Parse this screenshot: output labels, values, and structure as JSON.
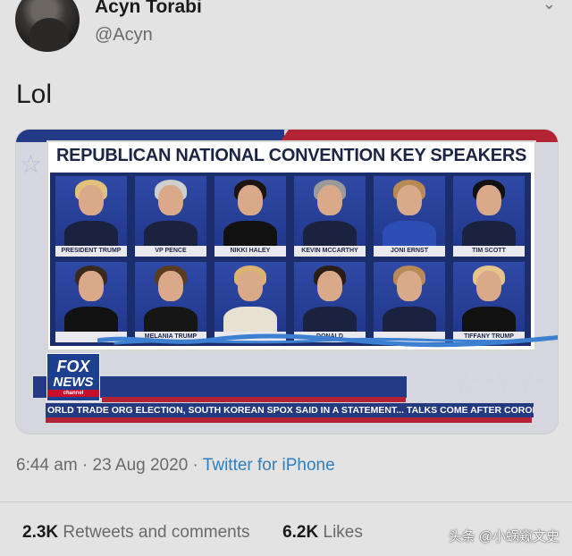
{
  "tweet": {
    "display_name": "Acyn Torabi",
    "handle": "@Acyn",
    "text": "Lol",
    "timestamp": "6:44 am · 23 Aug 2020 · ",
    "source": "Twitter for iPhone",
    "retweets_count": "2.3K",
    "retweets_label": "Retweets and comments",
    "likes_count": "6.2K",
    "likes_label": "Likes",
    "caret_icon": "chevron-down-icon"
  },
  "media": {
    "title": "REPUBLICAN NATIONAL CONVENTION KEY SPEAKERS",
    "row1_labels": [
      "PRESIDENT TRUMP",
      "VP PENCE",
      "NIKKI HALEY",
      "KEVIN MCCARTHY",
      "JONI ERNST",
      "TIM SCOTT"
    ],
    "row2_labels": [
      "",
      "MELANIA TRUMP",
      "",
      "DONALD",
      "",
      "TIFFANY TRUMP"
    ],
    "logo_fox": "FOX",
    "logo_news": "NEWS",
    "logo_channel": "channel",
    "ticker": "ORLD TRADE ORG ELECTION, SOUTH KOREAN SPOX SAID IN A STATEMENT...   TALKS COME AFTER CORONA",
    "colors": {
      "navy": "#233b86",
      "red": "#b32333",
      "scribble": "#3d7fd0"
    }
  },
  "watermark": "头条 @小蜗窥文史"
}
